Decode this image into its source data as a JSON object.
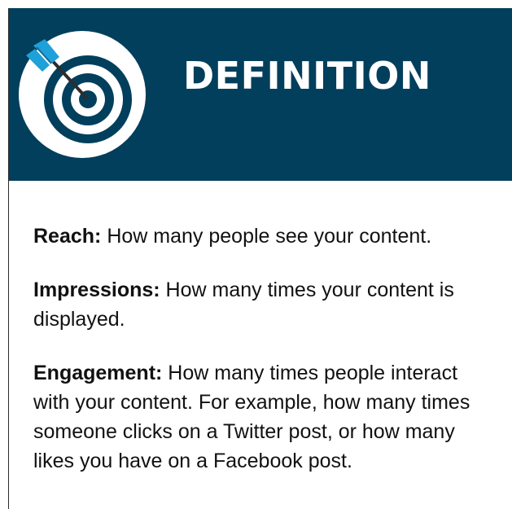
{
  "header": {
    "title": "DEFINITION",
    "icon": "target-with-arrow-icon"
  },
  "colors": {
    "header_background": "#023f5c",
    "title_text": "#ffffff",
    "target_ring_light": "#ffffff",
    "target_ring_dark": "#023f5c",
    "arrow_fletching": "#1ea0d8",
    "arrow_shaft": "#2d2d2d",
    "body_text": "#111111"
  },
  "definitions": [
    {
      "term": "Reach:",
      "description": " How many people see your content."
    },
    {
      "term": "Impressions:",
      "description": " How many times your content is displayed."
    },
    {
      "term": "Engagement:",
      "description": " How many times people interact with your content. For example, how many times someone clicks on a Twitter post, or how many likes you have on a Facebook post."
    }
  ]
}
